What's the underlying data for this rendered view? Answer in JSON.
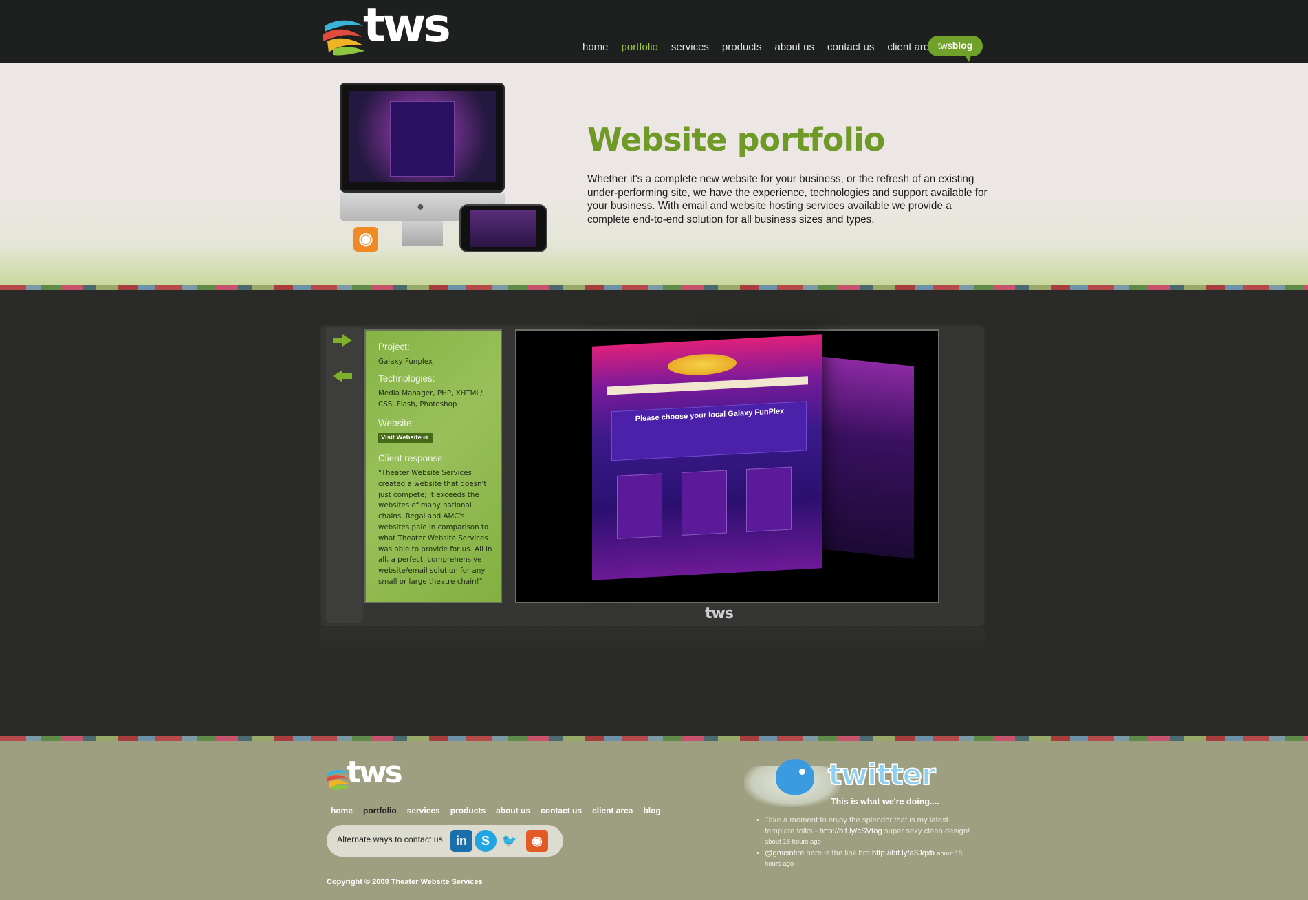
{
  "header": {
    "logo_text": "tws",
    "nav": [
      "home",
      "portfolio",
      "services",
      "products",
      "about us",
      "contact us",
      "client area"
    ],
    "active_nav": "portfolio",
    "blog_button": {
      "prefix": "tws",
      "label": "blog"
    }
  },
  "hero": {
    "title": "Website portfolio",
    "description": "Whether it's a complete new website for your business, or the refresh of an existing under-performing site, we have the experience, technologies and support available for your business. With email and website hosting services available we provide a complete end-to-end solution for all business sizes and types."
  },
  "portfolio": {
    "project_label": "Project:",
    "project_value": "Galaxy Funplex",
    "technologies_label": "Technologies:",
    "technologies_value": "Media Manager, PHP, XHTML/ CSS, Flash, Photoshop",
    "website_label": "Website:",
    "visit_button": "Visit Website ⇨",
    "client_response_label": "Client response:",
    "client_response_value": "\"Theater Website Services created a website that doesn't just compete; it exceeds the websites of many national chains. Regal and AMC's websites pale in comparison to what Theater Website Services was able to provide for us. All in all, a perfect, comprehensive website/email solution for any small or large theatre chain!\"",
    "screenshot": {
      "heading": "Please choose your local Galaxy FunPlex",
      "caption": "tws"
    }
  },
  "footer": {
    "logo_text": "tws",
    "nav": [
      "home",
      "portfolio",
      "services",
      "products",
      "about us",
      "contact us",
      "client area",
      "blog"
    ],
    "active_nav": "portfolio",
    "contact_label": "Alternate ways to contact us",
    "social": [
      {
        "name": "linkedin-icon",
        "glyph": "in",
        "color": "#1a6eaa"
      },
      {
        "name": "skype-icon",
        "glyph": "S",
        "color": "#1fa6e3"
      },
      {
        "name": "twitter-bird-icon",
        "glyph": "🐦",
        "color": "#2e9be3"
      },
      {
        "name": "rss-icon",
        "glyph": "◉",
        "color": "#e35a24"
      }
    ],
    "copyright": "Copyright © 2008 Theater Website Services",
    "twitter": {
      "wordmark": "twitter",
      "tagline": "This is what we're doing....",
      "tweets": [
        {
          "text": "Take a moment to enjoy the splendor that is my latest template folks - ",
          "link": "http://bit.ly/cSVtog",
          "text2": " super sexy clean design!",
          "ago": "about 18 hours ago"
        },
        {
          "text": "",
          "link": "@gmcintire",
          "text2": " here is the link bro ",
          "link2": "http://bit.ly/a3Jqxb",
          "ago": "about 18 hours ago"
        }
      ]
    }
  }
}
